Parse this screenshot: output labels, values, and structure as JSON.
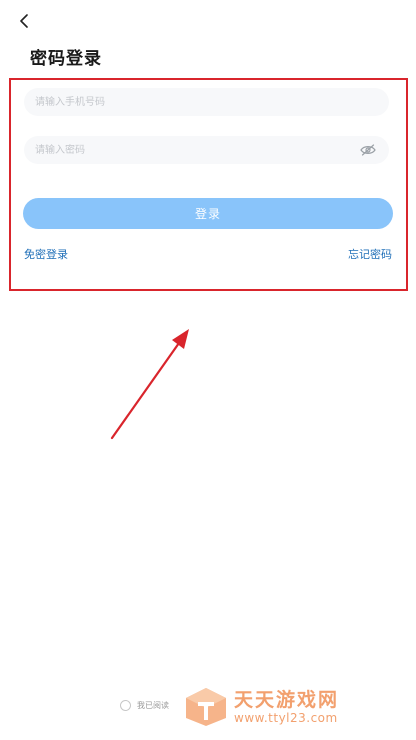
{
  "header": {
    "back_icon": "chevron-left-icon",
    "title": "密码登录"
  },
  "form": {
    "phone_placeholder": "请输入手机号码",
    "phone_value": "",
    "password_placeholder": "请输入密码",
    "password_value": "",
    "password_visibility_icon": "eye-off-icon",
    "login_label": "登录",
    "sms_login_label": "免密登录",
    "forgot_password_label": "忘记密码"
  },
  "footer": {
    "agreement_text": "我已阅读"
  },
  "watermark": {
    "title": "天天游戏网",
    "url": "www.ttyl23.com"
  },
  "colors": {
    "accent_button": "#89c4fa",
    "link": "#1f6fb8",
    "annotation_red": "#d9252c",
    "watermark": "#f2a06e"
  }
}
